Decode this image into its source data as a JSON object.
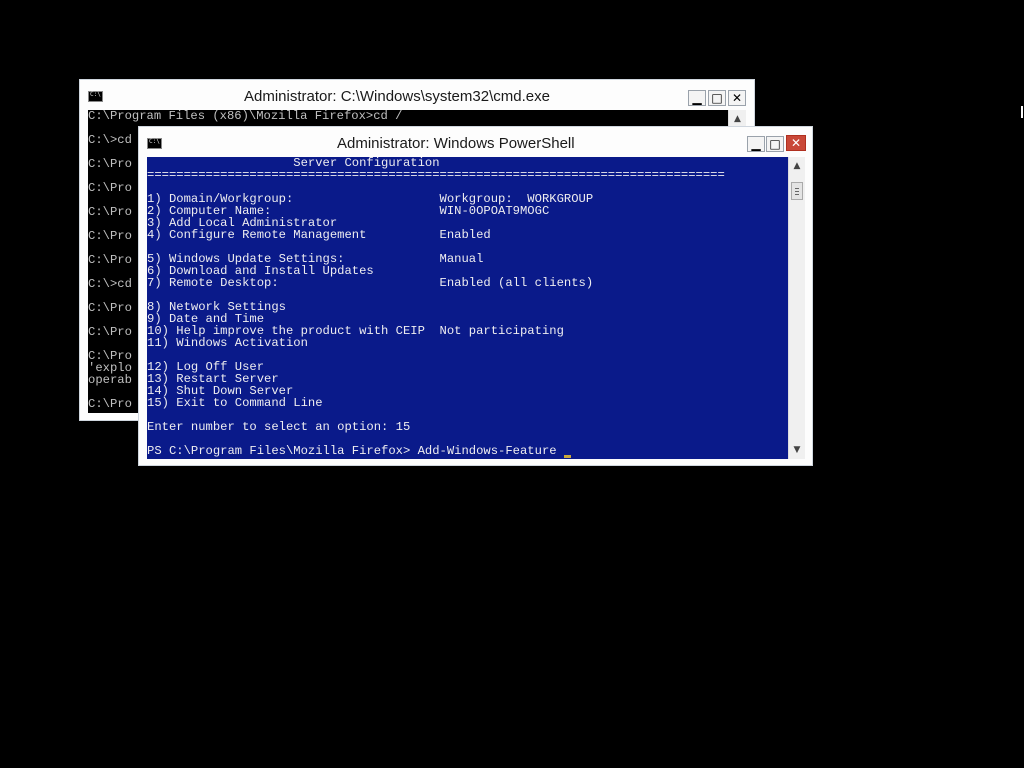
{
  "cmd_window": {
    "title": "Administrator: C:\\Windows\\system32\\cmd.exe",
    "lines": [
      "C:\\Program Files (x86)\\Mozilla Firefox>cd /",
      "",
      "C:\\>cd",
      "",
      "C:\\Pro",
      "",
      "C:\\Pro",
      "",
      "C:\\Pro",
      "",
      "C:\\Pro",
      "",
      "C:\\Pro",
      "",
      "C:\\>cd",
      "",
      "C:\\Pro",
      "",
      "C:\\Pro",
      "",
      "C:\\Pro",
      "'explo",
      "operab",
      "",
      "C:\\Pro"
    ]
  },
  "ps_window": {
    "title": "Administrator: Windows PowerShell",
    "lines": [
      "                    Server Configuration",
      "===============================================================================",
      "",
      "1) Domain/Workgroup:                    Workgroup:  WORKGROUP",
      "2) Computer Name:                       WIN-0OPOAT9MOGC",
      "3) Add Local Administrator",
      "4) Configure Remote Management          Enabled",
      "",
      "5) Windows Update Settings:             Manual",
      "6) Download and Install Updates",
      "7) Remote Desktop:                      Enabled (all clients)",
      "",
      "8) Network Settings",
      "9) Date and Time",
      "10) Help improve the product with CEIP  Not participating",
      "11) Windows Activation",
      "",
      "12) Log Off User",
      "13) Restart Server",
      "14) Shut Down Server",
      "15) Exit to Command Line",
      "",
      "Enter number to select an option: 15",
      "",
      "PS C:\\Program Files\\Mozilla Firefox> Add-Windows-Feature"
    ]
  },
  "controls": {
    "minimize_glyph": "▁",
    "maximize_glyph": "□",
    "close_glyph": "✕"
  },
  "colors": {
    "powershell_background": "#0a1a8a",
    "powershell_text": "#eeedf0",
    "cmd_background": "#000000",
    "cmd_text": "#c0c0c0",
    "close_button": "#c94838"
  }
}
